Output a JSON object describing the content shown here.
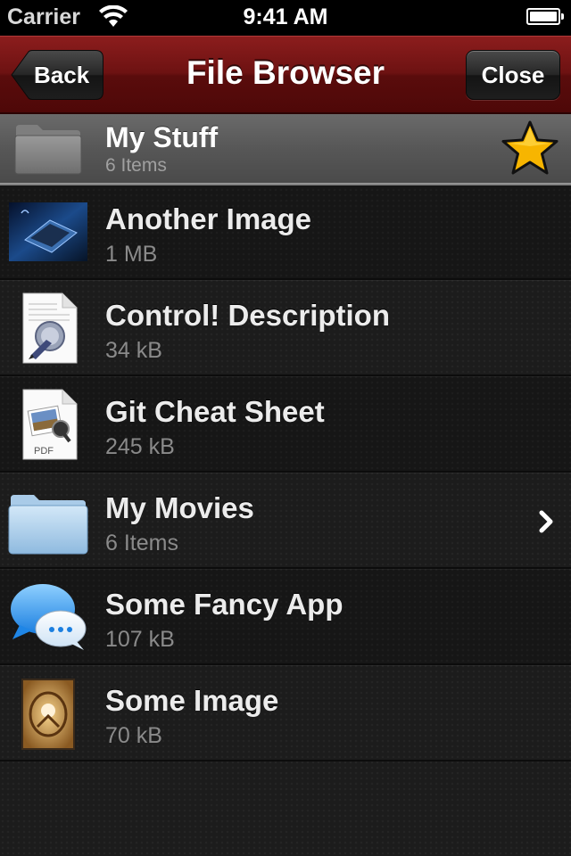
{
  "status_bar": {
    "carrier": "Carrier",
    "time": "9:41 AM"
  },
  "nav": {
    "title": "File Browser",
    "back_label": "Back",
    "close_label": "Close"
  },
  "header": {
    "title": "My Stuff",
    "subtitle": "6 Items",
    "icon": "folder-icon",
    "accessory": "star-icon"
  },
  "items": [
    {
      "title": "Another Image",
      "subtitle": "1 MB",
      "icon": "image-thumbnail-icon"
    },
    {
      "title": "Control! Description",
      "subtitle": "34 kB",
      "icon": "document-pen-icon"
    },
    {
      "title": "Git Cheat Sheet",
      "subtitle": "245 kB",
      "icon": "pdf-icon"
    },
    {
      "title": "My Movies",
      "subtitle": "6 Items",
      "icon": "folder-icon",
      "accessory": "chevron-right-icon"
    },
    {
      "title": "Some Fancy App",
      "subtitle": "107 kB",
      "icon": "chat-bubbles-icon"
    },
    {
      "title": "Some Image",
      "subtitle": "70 kB",
      "icon": "image-thumbnail-icon"
    }
  ],
  "colors": {
    "nav_bar": "#6d1212",
    "row_title": "#ececec",
    "row_subtitle": "#8a8a8a",
    "star": "#f5b800"
  }
}
